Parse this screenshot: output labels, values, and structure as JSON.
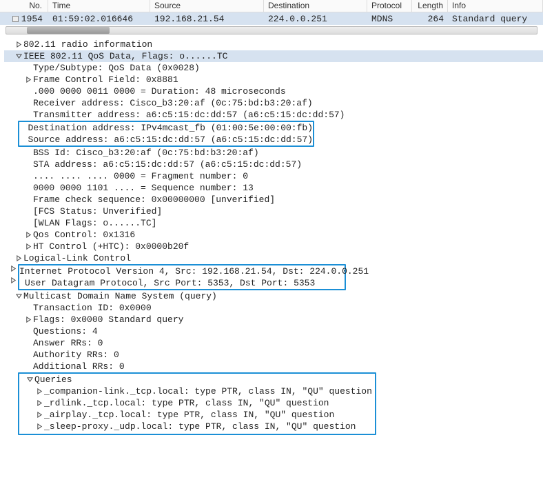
{
  "columns": {
    "no": "No.",
    "time": "Time",
    "source": "Source",
    "destination": "Destination",
    "protocol": "Protocol",
    "length": "Length",
    "info": "Info"
  },
  "packet": {
    "no": "1954",
    "time": "01:59:02.016646",
    "source": "192.168.21.54",
    "destination": "224.0.0.251",
    "protocol": "MDNS",
    "length": "264",
    "info": "Standard query"
  },
  "tree": {
    "radio": "802.11 radio information",
    "ieee": "IEEE 802.11 QoS Data, Flags: o......TC",
    "type_subtype": "Type/Subtype: QoS Data (0x0028)",
    "frame_ctrl": "Frame Control Field: 0x8881",
    "duration": ".000 0000 0011 0000 = Duration: 48 microseconds",
    "recv_addr": "Receiver address: Cisco_b3:20:af (0c:75:bd:b3:20:af)",
    "trans_addr": "Transmitter address: a6:c5:15:dc:dd:57 (a6:c5:15:dc:dd:57)",
    "dest_addr": "Destination address: IPv4mcast_fb (01:00:5e:00:00:fb)",
    "src_addr": "Source address: a6:c5:15:dc:dd:57 (a6:c5:15:dc:dd:57)",
    "bss": "BSS Id: Cisco_b3:20:af (0c:75:bd:b3:20:af)",
    "sta": "STA address: a6:c5:15:dc:dd:57 (a6:c5:15:dc:dd:57)",
    "frag": ".... .... .... 0000 = Fragment number: 0",
    "seq": "0000 0000 1101 .... = Sequence number: 13",
    "fcs": "Frame check sequence: 0x00000000 [unverified]",
    "fcs_status": "[FCS Status: Unverified]",
    "wlan_flags": "[WLAN Flags: o......TC]",
    "qos_ctrl": "Qos Control: 0x1316",
    "ht_ctrl": "HT Control (+HTC): 0x0000b20f",
    "llc": "Logical-Link Control",
    "ipv4": "Internet Protocol Version 4, Src: 192.168.21.54, Dst: 224.0.0.251",
    "udp": "User Datagram Protocol, Src Port: 5353, Dst Port: 5353",
    "mdns": "Multicast Domain Name System (query)",
    "txn": "Transaction ID: 0x0000",
    "flags": "Flags: 0x0000 Standard query",
    "questions": "Questions: 4",
    "answers": "Answer RRs: 0",
    "authority": "Authority RRs: 0",
    "additional": "Additional RRs: 0",
    "queries": "Queries",
    "q1": "_companion-link._tcp.local: type PTR, class IN, \"QU\" question",
    "q2": "_rdlink._tcp.local: type PTR, class IN, \"QU\" question",
    "q3": "_airplay._tcp.local: type PTR, class IN, \"QU\" question",
    "q4": "_sleep-proxy._udp.local: type PTR, class IN, \"QU\" question"
  }
}
